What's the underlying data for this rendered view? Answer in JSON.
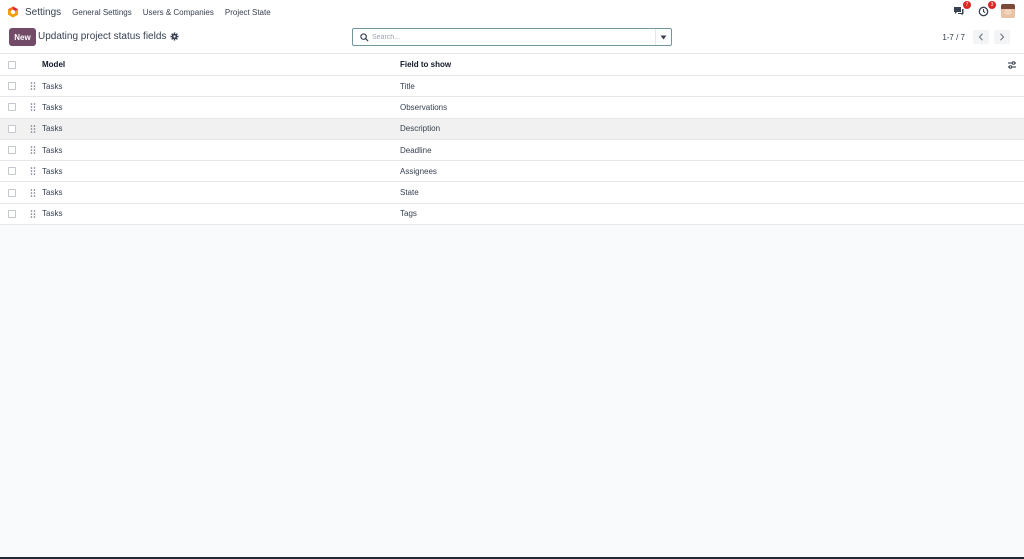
{
  "topbar": {
    "app_name": "Settings",
    "nav": [
      "General Settings",
      "Users & Companies",
      "Project State"
    ],
    "messages_badge": "7",
    "activities_badge": "3",
    "brand_color": "#714b67"
  },
  "control": {
    "new_label": "New",
    "title": "Updating project status fields",
    "search_placeholder": "Search...",
    "pager": "1-7 / 7"
  },
  "list": {
    "headers": {
      "model": "Model",
      "field": "Field to show"
    },
    "rows": [
      {
        "model": "Tasks",
        "field": "Title"
      },
      {
        "model": "Tasks",
        "field": "Observations"
      },
      {
        "model": "Tasks",
        "field": "Description"
      },
      {
        "model": "Tasks",
        "field": "Deadline"
      },
      {
        "model": "Tasks",
        "field": "Assignees"
      },
      {
        "model": "Tasks",
        "field": "State"
      },
      {
        "model": "Tasks",
        "field": "Tags"
      }
    ]
  }
}
